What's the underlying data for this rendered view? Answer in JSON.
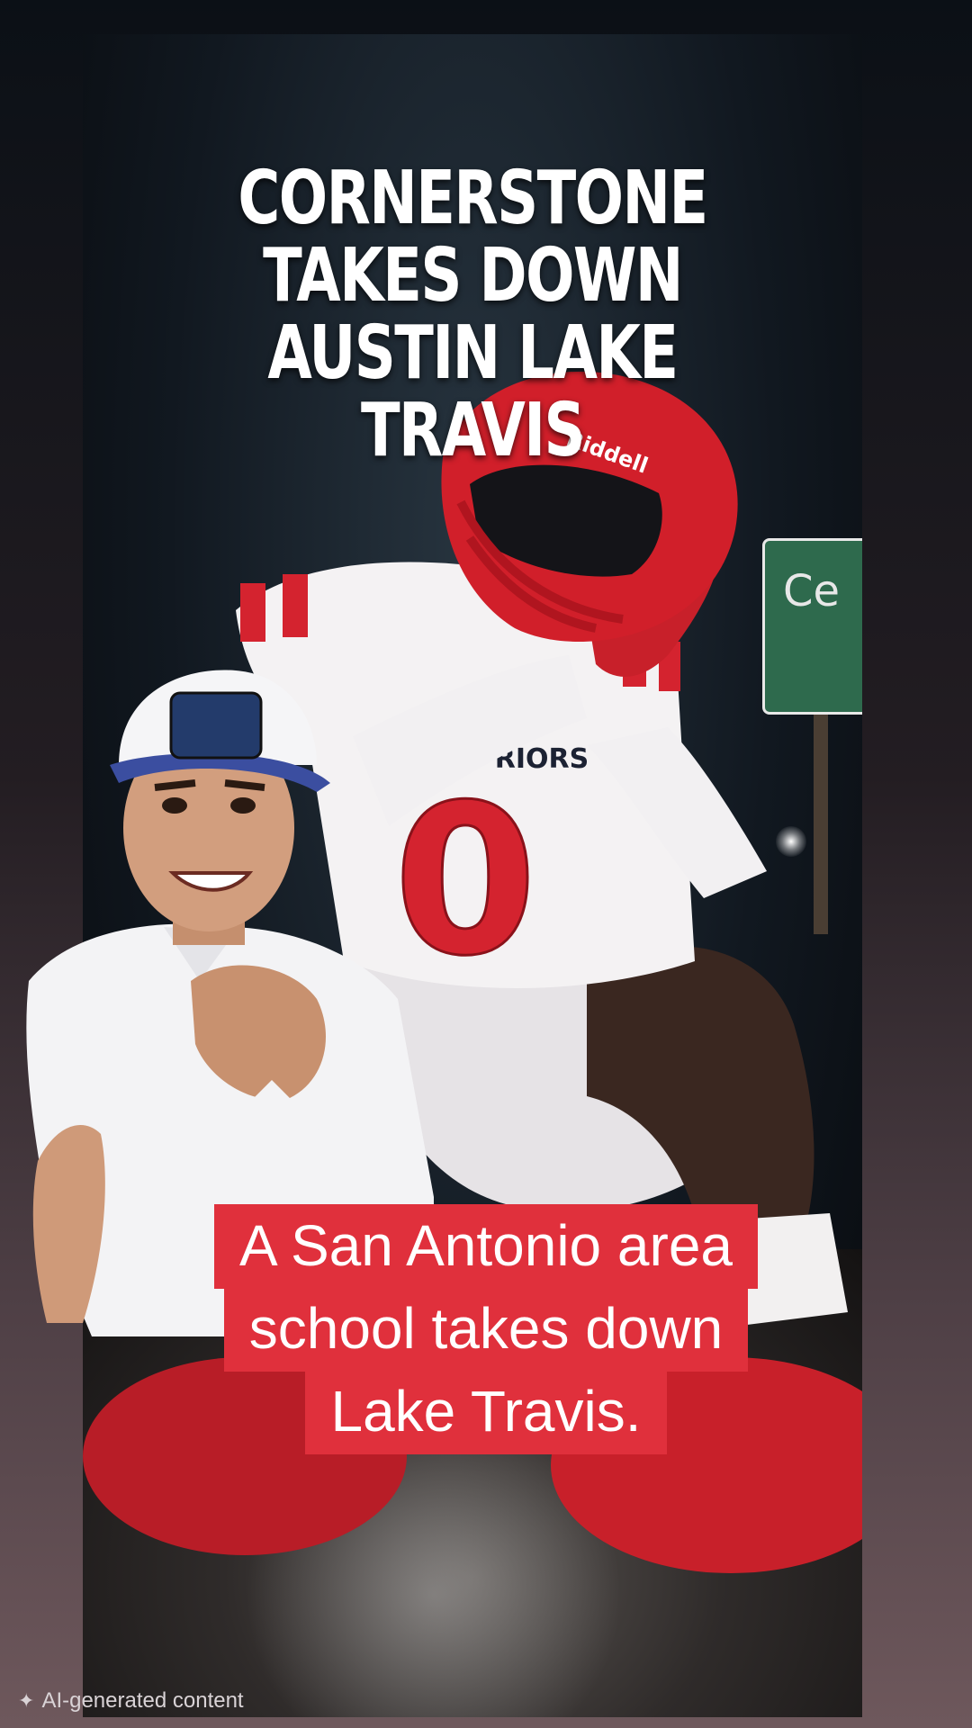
{
  "headline": {
    "lines": [
      "CORNERSTONE",
      "TAKES DOWN",
      "AUSTIN LAKE TRAVIS"
    ]
  },
  "imagery": {
    "helmet_brand": "Riddell",
    "jersey_text": "RIORS",
    "jersey_number": "0",
    "sign_text": "Ce"
  },
  "caption": {
    "lines": [
      "A San Antonio area",
      "school takes down",
      "Lake Travis."
    ]
  },
  "ai_label": {
    "icon": "sparkle-icon",
    "text": "AI-generated content"
  },
  "colors": {
    "caption_bg": "#e0303c",
    "jersey_red": "#d4232f",
    "sign_green": "#2e6a4d"
  }
}
